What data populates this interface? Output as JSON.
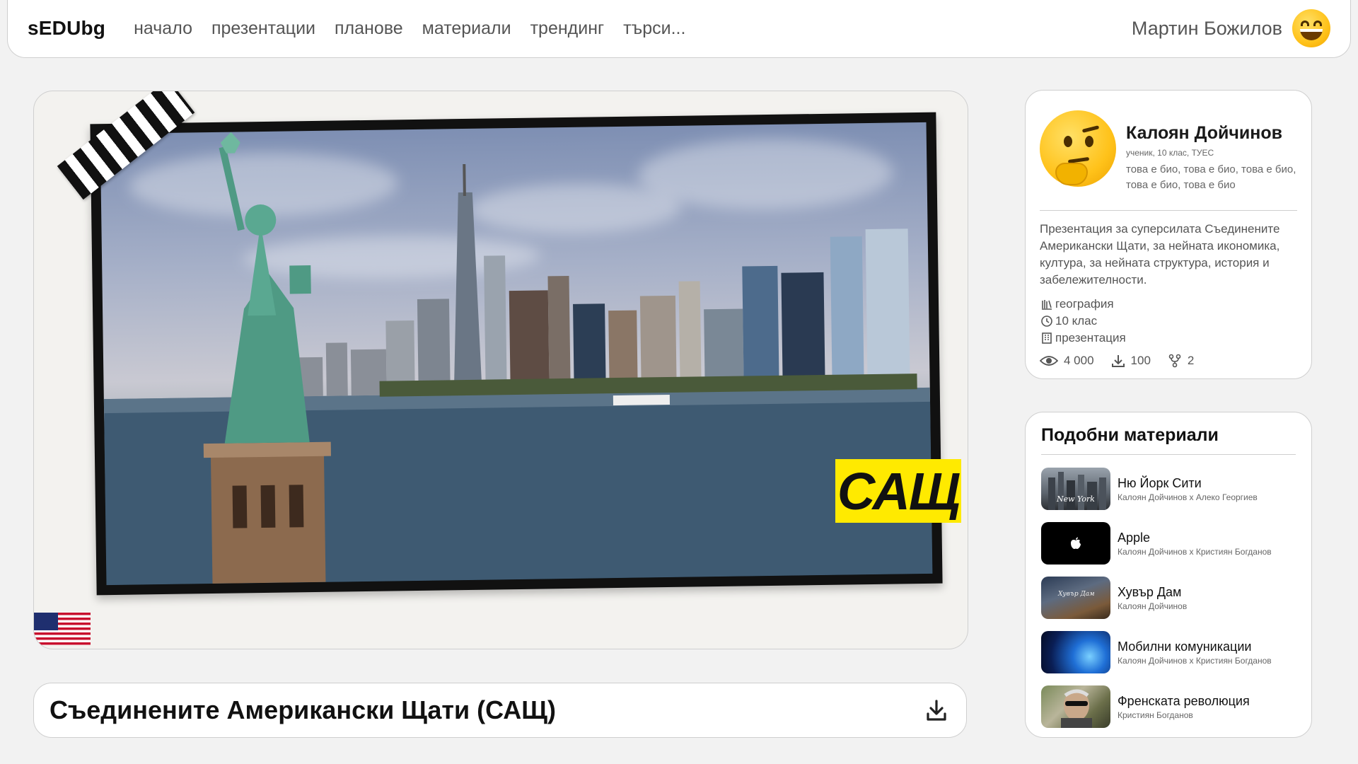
{
  "nav": {
    "logo": "sEDUbg",
    "links": [
      "начало",
      "презентации",
      "планове",
      "материали",
      "трендинг",
      "търси..."
    ],
    "user_name": "Мартин Божилов"
  },
  "preview": {
    "label": "САЩ"
  },
  "title": "Съединените Американски Щати (САЩ)",
  "author": {
    "name": "Калоян Дойчинов",
    "meta": "ученик, 10 клас, ТУЕС",
    "bio": "това е био, това е био, това е био, това е био, това е био",
    "description": "Презентация за суперсилата Съединените Американски Щати, за нейната икономика, култура, за нейната структура, история и забележителности.",
    "tags": {
      "subject": "география",
      "grade": "10 клас",
      "type": "презентация"
    },
    "stats": {
      "views": "4 000",
      "downloads": "100",
      "forks": "2"
    }
  },
  "similar": {
    "title": "Подобни материали",
    "items": [
      {
        "name": "Ню Йорк Сити",
        "authors": "Калоян Дойчинов x Алеко Георгиев",
        "thumb_text": "New York"
      },
      {
        "name": "Apple",
        "authors": "Калоян Дойчинов x Кристиян Богданов"
      },
      {
        "name": "Хувър Дам",
        "authors": "Калоян Дойчинов",
        "thumb_text": "Хувър Дам"
      },
      {
        "name": "Мобилни комуникации",
        "authors": "Калоян Дойчинов x Кристиян Богданов"
      },
      {
        "name": "Френската революция",
        "authors": "Кристиян Богданов"
      }
    ]
  }
}
